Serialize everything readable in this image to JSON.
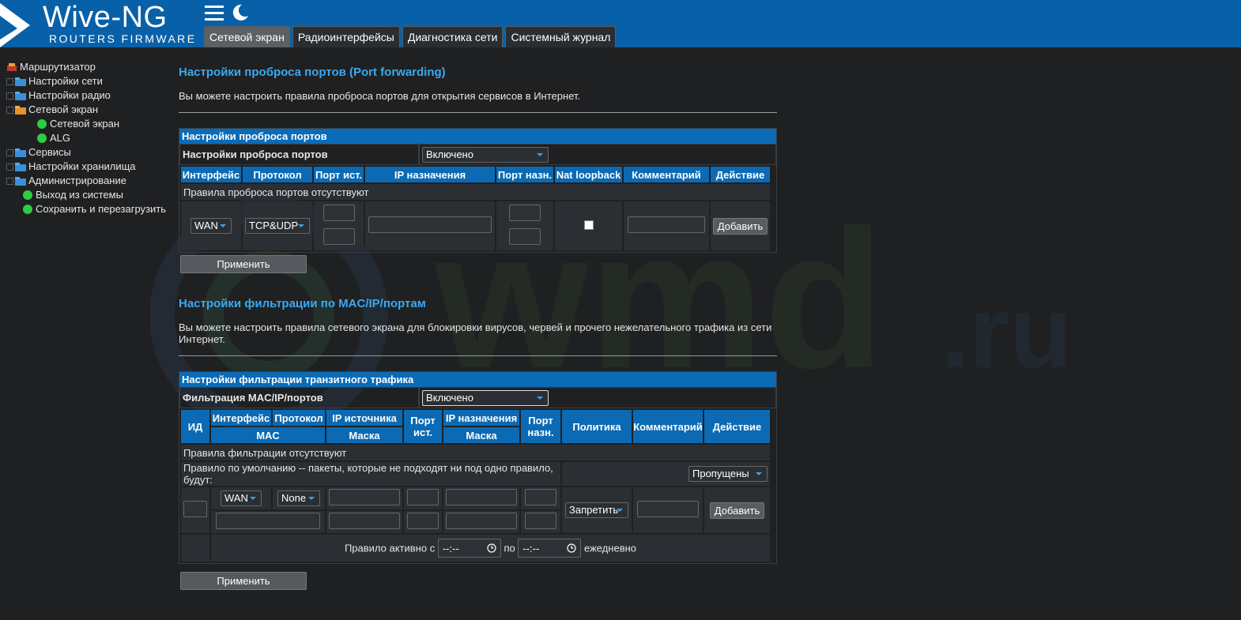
{
  "brand": {
    "title": "Wive-NG",
    "subtitle": "ROUTERS FIRMWARE"
  },
  "tabs": [
    {
      "label": "Сетевой экран",
      "active": true
    },
    {
      "label": "Радиоинтерфейсы"
    },
    {
      "label": "Диагностика сети"
    },
    {
      "label": "Системный журнал"
    }
  ],
  "tree": {
    "root": "Маршрутизатор",
    "items": [
      "Настройки сети",
      "Настройки радио",
      "Сетевой экран",
      "Сетевой экран",
      "ALG",
      "Сервисы",
      "Настройки хранилища",
      "Администрирование",
      "Выход из системы",
      "Сохранить и перезагрузить"
    ]
  },
  "pf": {
    "title": "Настройки проброса портов (Port forwarding)",
    "desc": "Вы можете настроить правила проброса портов для открытия сервисов в Интернет.",
    "caption": "Настройки проброса портов",
    "enable_label": "Настройки проброса портов",
    "enable_value": "Включено",
    "headers": [
      "Интерфейс",
      "Протокол",
      "Порт ист.",
      "IP назначения",
      "Порт назн.",
      "Nat loopback",
      "Комментарий",
      "Действие"
    ],
    "empty": "Правила проброса портов отсутствуют",
    "iface": "WAN",
    "proto": "TCP&UDP",
    "add": "Добавить",
    "apply": "Применить"
  },
  "ff": {
    "title": "Настройки фильтрации по MAC/IP/портам",
    "desc": "Вы можете настроить правила сетевого экрана для блокировки вирусов, червей и прочего нежелательного трафика из сети Интернет.",
    "caption": "Настройки фильтрации транзитного трафика",
    "enable_label": "Фильтрация MAC/IP/портов",
    "enable_value": "Включено",
    "h_id": "ИД",
    "h_iface": "Интерфейс",
    "h_proto": "Протокол",
    "h_mac": "MAC",
    "h_ipsrc": "IP источника",
    "h_mask": "Маска",
    "h_portsrc": "Порт ист.",
    "h_ipdst": "IP назначения",
    "h_mask2": "Маска",
    "h_portdst": "Порт назн.",
    "h_policy": "Политика",
    "h_comment": "Комментарий",
    "h_action": "Действие",
    "empty": "Правила фильтрации отсутствуют",
    "default_rule": "Правило по умолчанию -- пакеты, которые не подходят ни под одно правило, будут:",
    "default_value": "Пропущены",
    "iface": "WAN",
    "proto": "None",
    "policy": "Запретить",
    "add": "Добавить",
    "active_from": "Правило активно с",
    "time_placeholder": "--:--",
    "to": "по",
    "daily": "ежедневно",
    "apply": "Применить"
  }
}
